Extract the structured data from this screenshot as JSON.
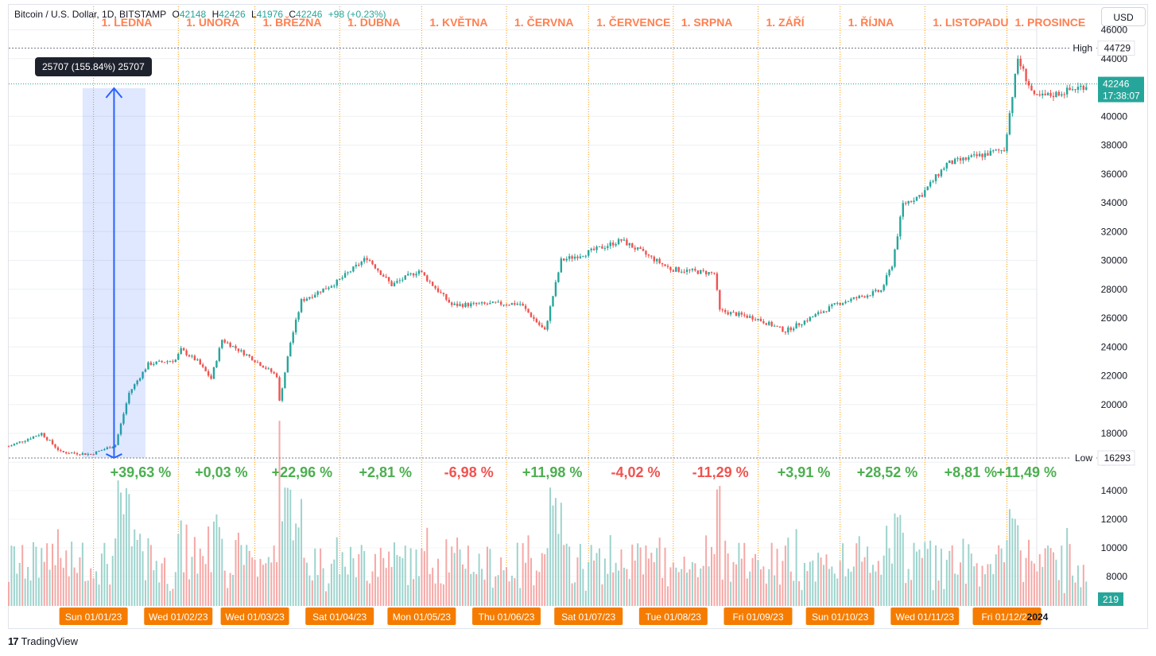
{
  "header": {
    "symbol": "Bitcoin / U.S. Dollar, 1D, BITSTAMP",
    "open_label": "O",
    "open": "42148",
    "high_label": "H",
    "high": "42426",
    "low_label": "L",
    "low": "41976",
    "close_label": "C",
    "close": "42246",
    "change": "+98 (+0.23%)"
  },
  "currency_button": "USD",
  "measure_tooltip": "25707 (155.84%) 25707",
  "high_marker": {
    "label": "High",
    "value": "44729"
  },
  "low_marker": {
    "label": "Low",
    "value": "16293"
  },
  "last_price": {
    "value": "42246",
    "countdown": "17:38:07"
  },
  "volume_badge": "219",
  "footer": {
    "logo": "17",
    "brand": "TradingView"
  },
  "colors": {
    "up": "#26a69a",
    "down": "#ef5350",
    "month_label": "#ff7f50",
    "month_line": "#ff9800",
    "measure": "#2962ff",
    "date_badge": "#f57c00"
  },
  "chart_data": {
    "type": "candlestick",
    "title": "Bitcoin / U.S. Dollar, 1D, BITSTAMP",
    "y_axis_ticks": [
      "46000",
      "44000",
      "40000",
      "38000",
      "36000",
      "34000",
      "32000",
      "30000",
      "28000",
      "26000",
      "24000",
      "22000",
      "20000",
      "18000",
      "16000"
    ],
    "volume_axis_ticks": [
      "14000",
      "12000",
      "10000",
      "8000"
    ],
    "ylim": [
      16000,
      46000
    ],
    "month_labels": [
      "1. LEDNA",
      "1. ÚNORA",
      "1. BŘEZNA",
      "1. DUBNA",
      "1. KVĚTNA",
      "1. ČERVNA",
      "1. ČERVENCE",
      "1. SRPNA",
      "1. ZÁŘÍ",
      "1. ŘÍJNA",
      "1. LISTOPADU",
      "1. PROSINCE"
    ],
    "monthly_changes": [
      "+39,63 %",
      "+0,03 %",
      "+22,96 %",
      "+2,81 %",
      "-6,98 %",
      "+11,98 %",
      "-4,02 %",
      "-11,29 %",
      "+3,91 %",
      "+28,52 %",
      "+8,81 %",
      "+11,49 %"
    ],
    "date_labels": [
      "Sun 01/01/23",
      "Wed 01/02/23",
      "Wed 01/03/23",
      "Sat 01/04/23",
      "Mon 01/05/23",
      "Thu 01/06/23",
      "Sat 01/07/23",
      "Tue 01/08/23",
      "Fri 01/09/23",
      "Sun 01/10/23",
      "Wed 01/11/23",
      "Fri 01/12/23"
    ],
    "year_label": "2024",
    "price_path": [
      [
        "2022-12-01",
        17100
      ],
      [
        "2022-12-13",
        18000
      ],
      [
        "2022-12-20",
        16700
      ],
      [
        "2022-12-31",
        16550
      ],
      [
        "2023-01-09",
        17200
      ],
      [
        "2023-01-14",
        20800
      ],
      [
        "2023-01-21",
        22800
      ],
      [
        "2023-01-31",
        23100
      ],
      [
        "2023-02-02",
        23800
      ],
      [
        "2023-02-08",
        23000
      ],
      [
        "2023-02-13",
        21800
      ],
      [
        "2023-02-17",
        24500
      ],
      [
        "2023-02-28",
        23200
      ],
      [
        "2023-03-09",
        22000
      ],
      [
        "2023-03-10",
        20200
      ],
      [
        "2023-03-14",
        24300
      ],
      [
        "2023-03-18",
        27200
      ],
      [
        "2023-03-31",
        28500
      ],
      [
        "2023-04-11",
        30200
      ],
      [
        "2023-04-20",
        28300
      ],
      [
        "2023-04-30",
        29300
      ],
      [
        "2023-05-12",
        26900
      ],
      [
        "2023-05-31",
        27000
      ],
      [
        "2023-06-06",
        27000
      ],
      [
        "2023-06-15",
        25100
      ],
      [
        "2023-06-21",
        30000
      ],
      [
        "2023-06-30",
        30500
      ],
      [
        "2023-07-13",
        31400
      ],
      [
        "2023-07-31",
        29400
      ],
      [
        "2023-08-16",
        29100
      ],
      [
        "2023-08-18",
        26500
      ],
      [
        "2023-08-31",
        26000
      ],
      [
        "2023-09-11",
        25100
      ],
      [
        "2023-09-30",
        27000
      ],
      [
        "2023-10-16",
        27900
      ],
      [
        "2023-10-20",
        29700
      ],
      [
        "2023-10-24",
        33900
      ],
      [
        "2023-10-31",
        34600
      ],
      [
        "2023-11-09",
        36700
      ],
      [
        "2023-11-30",
        37700
      ],
      [
        "2023-12-05",
        44000
      ],
      [
        "2023-12-11",
        41300
      ],
      [
        "2023-12-18",
        41500
      ],
      [
        "2023-12-31",
        42200
      ]
    ]
  }
}
